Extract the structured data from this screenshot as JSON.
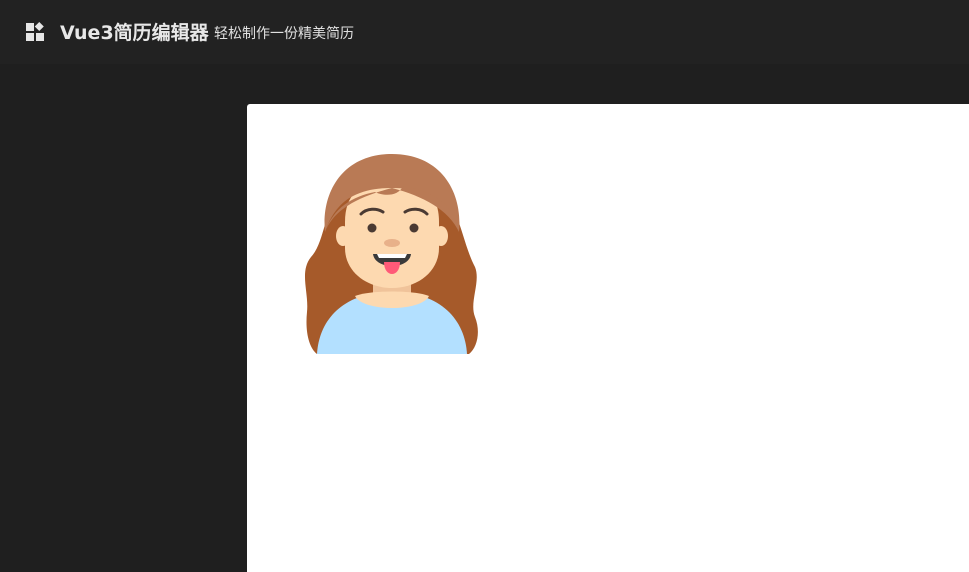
{
  "header": {
    "title": "Vue3简历编辑器",
    "subtitle": "轻松制作一份精美简历",
    "logo_icon": "widgets-icon"
  },
  "resume": {
    "avatar_icon": "female-avatar-icon"
  },
  "colors": {
    "header_bg": "#222222",
    "workspace_bg": "#1f1f1f",
    "paper_bg": "#ffffff",
    "hair_dark": "#a65a2a",
    "hair_light": "#b97a55",
    "skin": "#fdd9b0",
    "shirt": "#b3e0ff",
    "tongue": "#ff5a78"
  }
}
